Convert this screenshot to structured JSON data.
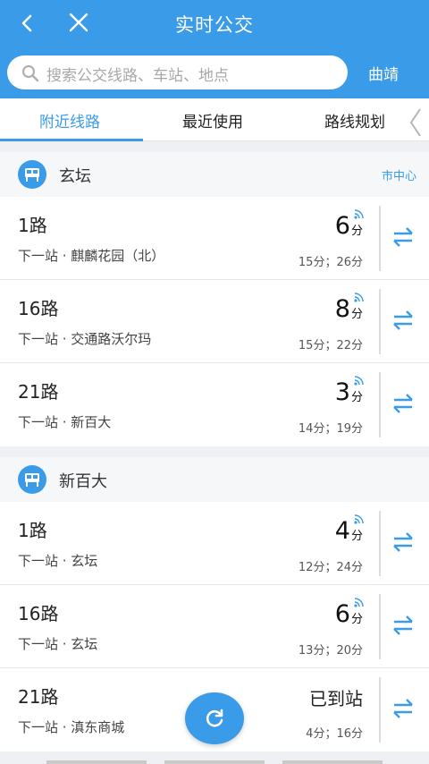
{
  "header": {
    "title": "实时公交",
    "back_icon": "chevron-left-icon",
    "close_icon": "close-icon"
  },
  "search": {
    "placeholder": "搜索公交线路、车站、地点",
    "city": "曲靖"
  },
  "tabs": [
    {
      "label": "附近线路",
      "active": true
    },
    {
      "label": "最近使用",
      "active": false
    },
    {
      "label": "路线规划",
      "active": false
    }
  ],
  "stations": [
    {
      "name": "玄坛",
      "region": "市中心",
      "routes": [
        {
          "number": "1路",
          "next_stop": "下一站 · 麒麟花园（北）",
          "eta": "6",
          "eta_unit": "分",
          "times": "15分；26分"
        },
        {
          "number": "16路",
          "next_stop": "下一站 · 交通路沃尔玛",
          "eta": "8",
          "eta_unit": "分",
          "times": "15分；22分"
        },
        {
          "number": "21路",
          "next_stop": "下一站 · 新百大",
          "eta": "3",
          "eta_unit": "分",
          "times": "14分；19分"
        }
      ]
    },
    {
      "name": "新百大",
      "routes": [
        {
          "number": "1路",
          "next_stop": "下一站 · 玄坛",
          "eta": "4",
          "eta_unit": "分",
          "times": "12分；24分"
        },
        {
          "number": "16路",
          "next_stop": "下一站 · 玄坛",
          "eta": "6",
          "eta_unit": "分",
          "times": "13分；20分"
        },
        {
          "number": "21路",
          "next_stop": "下一站 · 滇东商城",
          "eta_status": "已到站",
          "times": "4分；16分"
        }
      ]
    }
  ],
  "colors": {
    "accent": "#3a9be8",
    "background": "#eef0f3"
  },
  "icons": {
    "swap": "swap-direction-icon",
    "signal": "realtime-signal-icon",
    "refresh": "refresh-icon",
    "station": "bus-stop-icon"
  }
}
